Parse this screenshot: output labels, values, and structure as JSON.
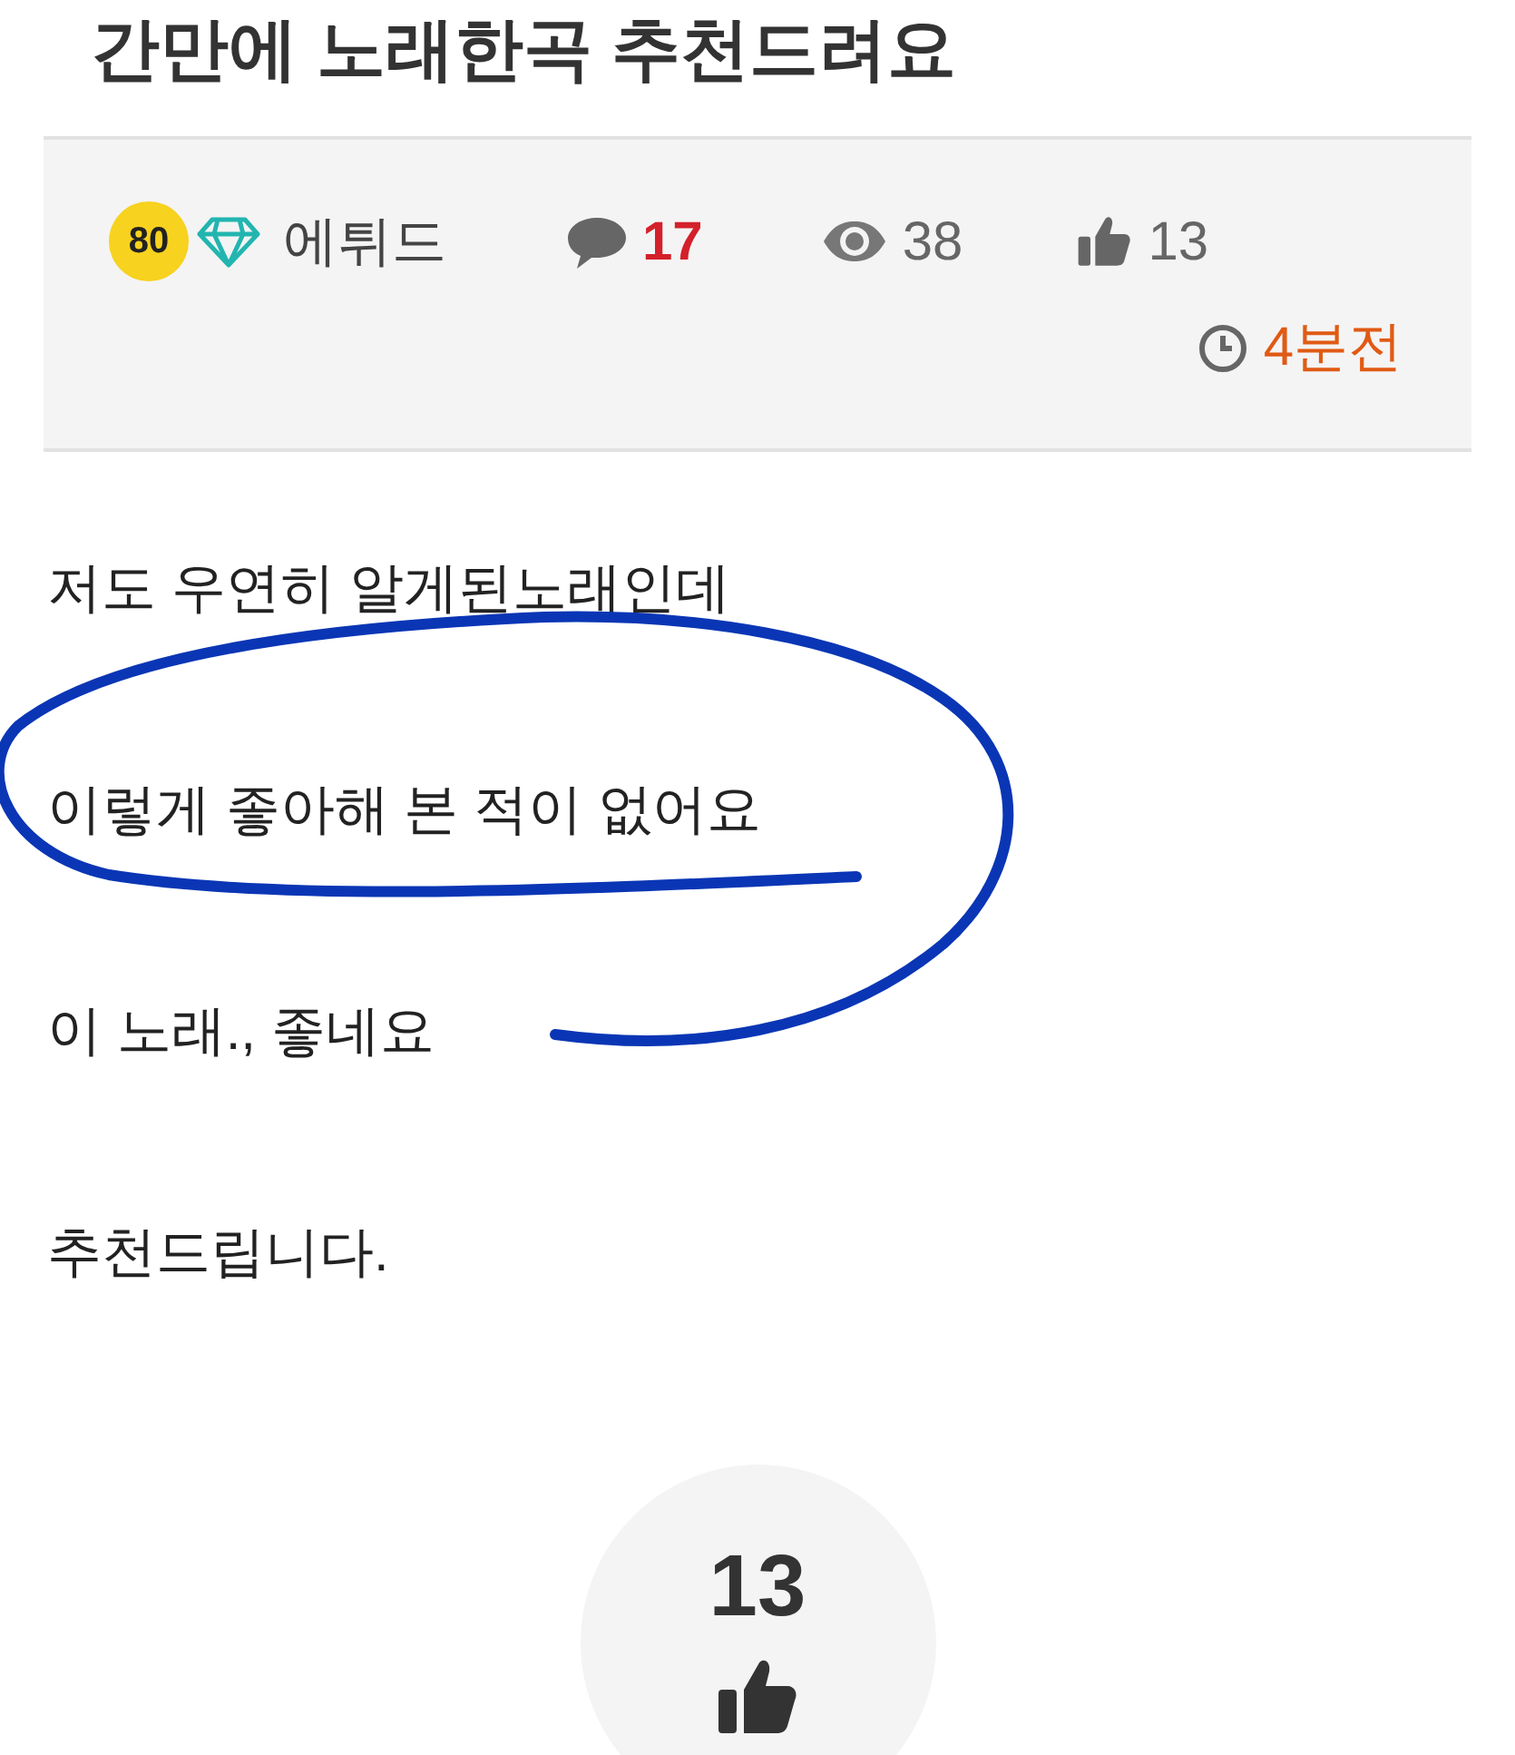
{
  "title": "간만에 노래한곡 추천드려요",
  "meta": {
    "level": "80",
    "author": "에튀드",
    "comments": "17",
    "views": "38",
    "likes": "13",
    "time": "4분전"
  },
  "body": [
    "저도 우연히 알게된노래인데",
    "이렇게 좋아해 본 적이 없어요",
    "이 노래., 좋네요",
    "추천드립니다."
  ],
  "like_button": {
    "count": "13"
  }
}
